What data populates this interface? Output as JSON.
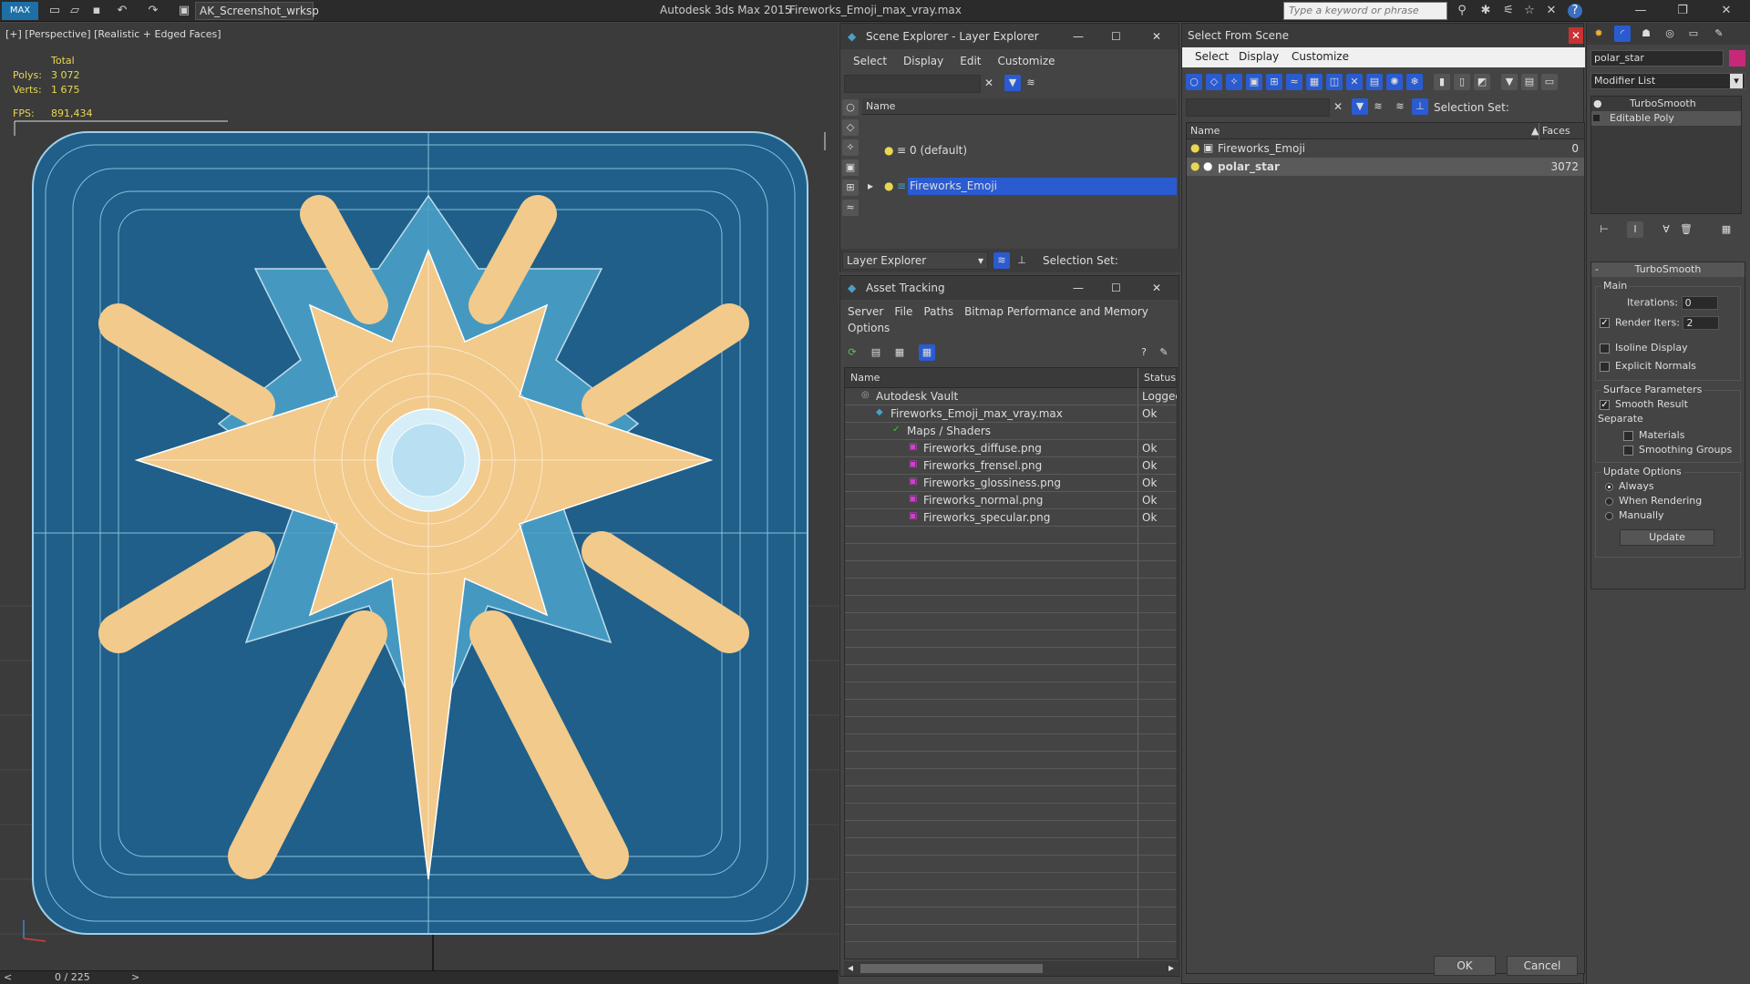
{
  "app": {
    "title": "Autodesk 3ds Max  2015",
    "file": "Fireworks_Emoji_max_vray.max",
    "workspace": "AK_Screenshot_wrksp",
    "search_placeholder": "Type a keyword or phrase"
  },
  "viewport": {
    "label": "[+] [Perspective] [Realistic + Edged Faces]",
    "stats_header": "Total",
    "polys_label": "Polys:",
    "polys_value": "3 072",
    "verts_label": "Verts:",
    "verts_value": "1 675",
    "fps_label": "FPS:",
    "fps_value": "891,434"
  },
  "timeline": {
    "frame": "0 / 225"
  },
  "scene_explorer": {
    "title": "Scene Explorer - Layer Explorer",
    "menu": [
      "Select",
      "Display",
      "Edit",
      "Customize"
    ],
    "col_name": "Name",
    "rows": [
      "0 (default)",
      "Fireworks_Emoji"
    ],
    "footer_label": "Layer Explorer",
    "selection_set_label": "Selection Set:"
  },
  "asset_tracking": {
    "title": "Asset Tracking",
    "menu": [
      "Server",
      "File",
      "Paths",
      "Bitmap Performance and Memory"
    ],
    "menu2": "Options",
    "col_name": "Name",
    "col_status": "Status",
    "rows": [
      {
        "name": "Autodesk Vault",
        "status": "Logged",
        "indent": 0
      },
      {
        "name": "Fireworks_Emoji_max_vray.max",
        "status": "Ok",
        "indent": 1
      },
      {
        "name": "Maps / Shaders",
        "status": "",
        "indent": 2
      },
      {
        "name": "Fireworks_diffuse.png",
        "status": "Ok",
        "indent": 3
      },
      {
        "name": "Fireworks_frensel.png",
        "status": "Ok",
        "indent": 3
      },
      {
        "name": "Fireworks_glossiness.png",
        "status": "Ok",
        "indent": 3
      },
      {
        "name": "Fireworks_normal.png",
        "status": "Ok",
        "indent": 3
      },
      {
        "name": "Fireworks_specular.png",
        "status": "Ok",
        "indent": 3
      }
    ]
  },
  "select_from_scene": {
    "title": "Select From Scene",
    "menu": [
      "Select",
      "Display",
      "Customize"
    ],
    "selection_set_label": "Selection Set:",
    "col_name": "Name",
    "col_faces": "Faces",
    "rows": [
      {
        "name": "Fireworks_Emoji",
        "faces": "0"
      },
      {
        "name": "polar_star",
        "faces": "3072"
      }
    ],
    "ok": "OK",
    "cancel": "Cancel"
  },
  "modifier_panel": {
    "object_name": "polar_star",
    "object_color": "#c8287a",
    "modifier_list": "Modifier List",
    "stack": [
      "TurboSmooth",
      "Editable Poly"
    ],
    "rollout_title": "TurboSmooth",
    "main_label": "Main",
    "iterations_label": "Iterations:",
    "iterations_value": "0",
    "render_iters_label": "Render Iters:",
    "render_iters_value": "2",
    "isoline_label": "Isoline Display",
    "explicit_normals_label": "Explicit Normals",
    "surface_params_label": "Surface Parameters",
    "smooth_result_label": "Smooth Result",
    "separate_label": "Separate",
    "materials_label": "Materials",
    "smoothing_groups_label": "Smoothing Groups",
    "update_options_label": "Update Options",
    "always_label": "Always",
    "when_rendering_label": "When Rendering",
    "manually_label": "Manually",
    "update_button": "Update"
  },
  "colors": {
    "accent_blue": "#2a5bd0",
    "star_fill": "#f2ca8c",
    "base_fill": "#1f5f8a",
    "stats_yellow": "#e8d850"
  }
}
